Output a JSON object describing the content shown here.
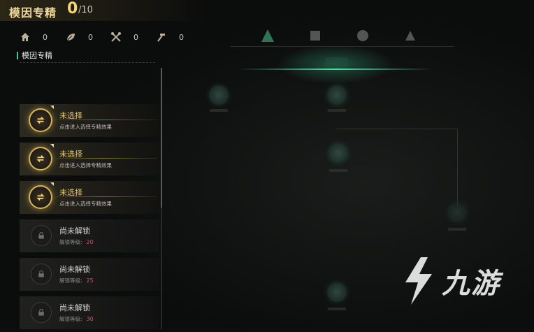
{
  "header": {
    "title": "模因专精",
    "count_current": "0",
    "count_max": "/10"
  },
  "resources": [
    {
      "icon": "home-icon",
      "value": "0"
    },
    {
      "icon": "leaf-icon",
      "value": "0"
    },
    {
      "icon": "crossed-tools-icon",
      "value": "0"
    },
    {
      "icon": "hammer-icon",
      "value": "0"
    }
  ],
  "section": {
    "title": "模因专精"
  },
  "slots": [
    {
      "state": "selectable",
      "name": "未选择",
      "desc": "点击进入选择专精效果"
    },
    {
      "state": "selectable",
      "name": "未选择",
      "desc": "点击进入选择专精效果"
    },
    {
      "state": "selectable",
      "name": "未选择",
      "desc": "点击进入选择专精效果"
    },
    {
      "state": "locked",
      "name": "尚未解锁",
      "desc": "解锁等级:",
      "level": "20"
    },
    {
      "state": "locked",
      "name": "尚未解锁",
      "desc": "解锁等级:",
      "level": "25"
    },
    {
      "state": "locked",
      "name": "尚未解锁",
      "desc": "解锁等级:",
      "level": "30"
    }
  ],
  "watermark": {
    "text": "九游"
  },
  "colors": {
    "gold": "#e9c86e",
    "accent_green": "#4cc59a",
    "level_red": "#d2566a"
  }
}
